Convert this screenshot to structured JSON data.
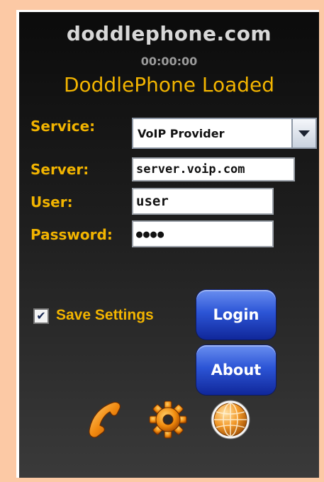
{
  "brand": "doddlephone.com",
  "timer": "00:00:00",
  "status": "DoddlePhone Loaded",
  "form": {
    "service_label": "Service:",
    "service_value": "VoIP Provider",
    "server_label": "Server:",
    "server_value": "server.voip.com",
    "user_label": "User:",
    "user_value": "user",
    "password_label": "Password:",
    "password_value": "●●●●"
  },
  "save_settings": {
    "label": "Save Settings",
    "checked": true,
    "mark": "✔"
  },
  "buttons": {
    "login": "Login",
    "about": "About"
  },
  "icons": [
    "phone-icon",
    "gear-icon",
    "globe-icon"
  ],
  "colors": {
    "accent": "#f2b400",
    "button": "#2c55d6",
    "background": "#fcc9a5"
  }
}
